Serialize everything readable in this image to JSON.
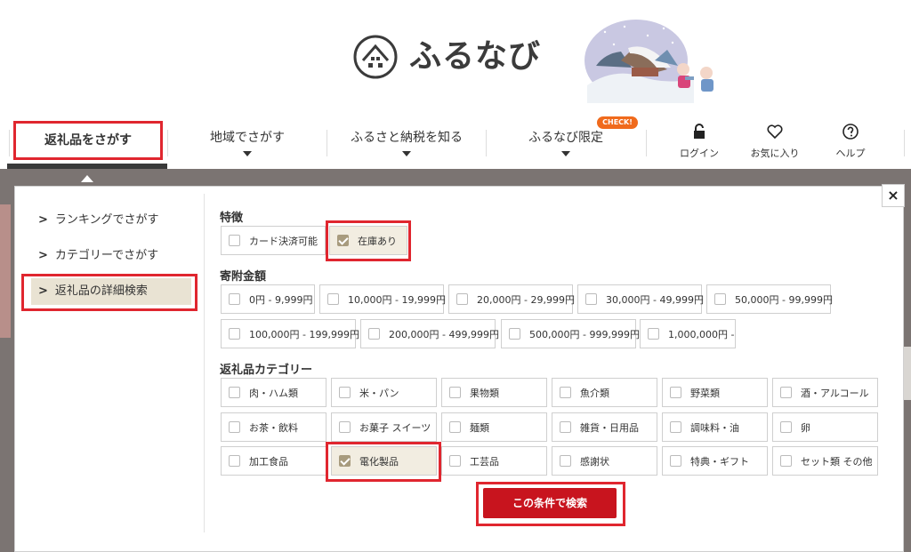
{
  "colors": {
    "accent_red": "#c8141e",
    "highlight_red": "#e0262f",
    "checked_bg": "#f2ede1",
    "badge_orange": "#f06a1c"
  },
  "logo": {
    "text": "ふるなび"
  },
  "nav": {
    "items": [
      {
        "label": "返礼品をさがす"
      },
      {
        "label": "地域でさがす"
      },
      {
        "label": "ふるさと納税を知る"
      },
      {
        "label": "ふるなび限定"
      }
    ],
    "badge": "CHECK!",
    "utils": [
      {
        "label": "ログイン",
        "icon": "lock-icon"
      },
      {
        "label": "お気に入り",
        "icon": "heart-icon"
      },
      {
        "label": "ヘルプ",
        "icon": "help-icon"
      }
    ]
  },
  "panel": {
    "close": "×",
    "side": [
      {
        "label": "ランキングでさがす"
      },
      {
        "label": "カテゴリーでさがす"
      },
      {
        "label": "返礼品の詳細検索"
      }
    ],
    "features": {
      "title": "特徴",
      "options": [
        {
          "label": "カード決済可能",
          "checked": false
        },
        {
          "label": "在庫あり",
          "checked": true
        }
      ]
    },
    "amount": {
      "title": "寄附金額",
      "options": [
        {
          "label": "0円 - 9,999円"
        },
        {
          "label": "10,000円 - 19,999円"
        },
        {
          "label": "20,000円 - 29,999円"
        },
        {
          "label": "30,000円 - 49,999円"
        },
        {
          "label": "50,000円 - 99,999円"
        },
        {
          "label": "100,000円 - 199,999円"
        },
        {
          "label": "200,000円 - 499,999円"
        },
        {
          "label": "500,000円 - 999,999円"
        },
        {
          "label": "1,000,000円 -"
        }
      ]
    },
    "category": {
      "title": "返礼品カテゴリー",
      "options": [
        {
          "label": "肉・ハム類",
          "checked": false
        },
        {
          "label": "米・パン",
          "checked": false
        },
        {
          "label": "果物類",
          "checked": false
        },
        {
          "label": "魚介類",
          "checked": false
        },
        {
          "label": "野菜類",
          "checked": false
        },
        {
          "label": "酒・アルコール",
          "checked": false
        },
        {
          "label": "お茶・飲料",
          "checked": false
        },
        {
          "label": "お菓子 スイーツ",
          "checked": false
        },
        {
          "label": "麺類",
          "checked": false
        },
        {
          "label": "雑貨・日用品",
          "checked": false
        },
        {
          "label": "調味料・油",
          "checked": false
        },
        {
          "label": "卵",
          "checked": false
        },
        {
          "label": "加工食品",
          "checked": false
        },
        {
          "label": "電化製品",
          "checked": true
        },
        {
          "label": "工芸品",
          "checked": false
        },
        {
          "label": "感謝状",
          "checked": false
        },
        {
          "label": "特典・ギフト",
          "checked": false
        },
        {
          "label": "セット類 その他",
          "checked": false
        }
      ]
    },
    "search_button": "この条件で検索"
  }
}
